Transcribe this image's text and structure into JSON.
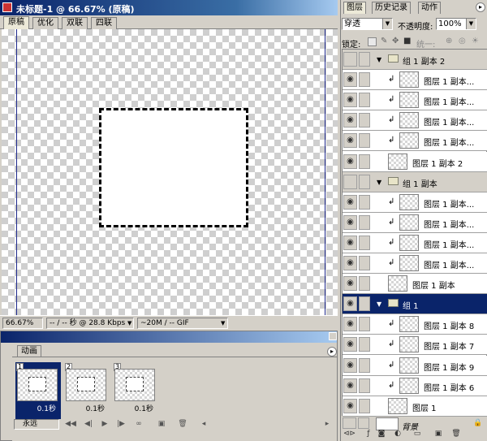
{
  "document": {
    "title": "未标题-1 @ 66.67% (原稿)",
    "view_tabs": [
      "原稿",
      "优化",
      "双联",
      "四联"
    ]
  },
  "status_bar": {
    "zoom": "66.67%",
    "download_time": "-- / -- 秒 @ 28.8 Kbps",
    "size": "~20M / -- GIF"
  },
  "animation": {
    "tab": "动画",
    "frames": [
      {
        "number": "1",
        "delay": "0.1秒"
      },
      {
        "number": "2",
        "delay": "0.1秒"
      },
      {
        "number": "3",
        "delay": "0.1秒"
      }
    ],
    "loop": "永远"
  },
  "layers_panel": {
    "tabs": [
      "图层",
      "历史记录",
      "动作"
    ],
    "blend_mode": "穿透",
    "opacity_label": "不透明度:",
    "opacity_value": "100%",
    "lock_label": "锁定:",
    "unify_label": "统一:",
    "rows": [
      {
        "type": "group",
        "name": "组 1 副本 2",
        "eye": false
      },
      {
        "type": "layer",
        "name": "图层 1 副本...",
        "clip": true,
        "eye": true
      },
      {
        "type": "layer",
        "name": "图层 1 副本...",
        "clip": true,
        "eye": true
      },
      {
        "type": "layer",
        "name": "图层 1 副本...",
        "clip": true,
        "eye": true
      },
      {
        "type": "layer",
        "name": "图层 1 副本...",
        "clip": true,
        "eye": true
      },
      {
        "type": "layer",
        "name": "图层 1 副本 2",
        "clip": false,
        "eye": true
      },
      {
        "type": "group",
        "name": "组 1 副本",
        "eye": false
      },
      {
        "type": "layer",
        "name": "图层 1 副本...",
        "clip": true,
        "eye": true
      },
      {
        "type": "layer",
        "name": "图层 1 副本...",
        "clip": true,
        "eye": true
      },
      {
        "type": "layer",
        "name": "图层 1 副本...",
        "clip": true,
        "eye": true
      },
      {
        "type": "layer",
        "name": "图层 1 副本...",
        "clip": true,
        "eye": true
      },
      {
        "type": "layer",
        "name": "图层 1 副本",
        "clip": false,
        "eye": true
      },
      {
        "type": "group",
        "name": "组 1",
        "eye": true,
        "selected": true
      },
      {
        "type": "layer",
        "name": "图层 1 副本 8",
        "clip": true,
        "eye": true
      },
      {
        "type": "layer",
        "name": "图层 1 副本 7",
        "clip": true,
        "eye": true
      },
      {
        "type": "layer",
        "name": "图层 1 副本 9",
        "clip": true,
        "eye": true
      },
      {
        "type": "layer",
        "name": "图层 1 副本 6",
        "clip": true,
        "eye": true
      },
      {
        "type": "layer",
        "name": "图层 1",
        "clip": false,
        "eye": true
      }
    ],
    "background_label": "背景"
  }
}
